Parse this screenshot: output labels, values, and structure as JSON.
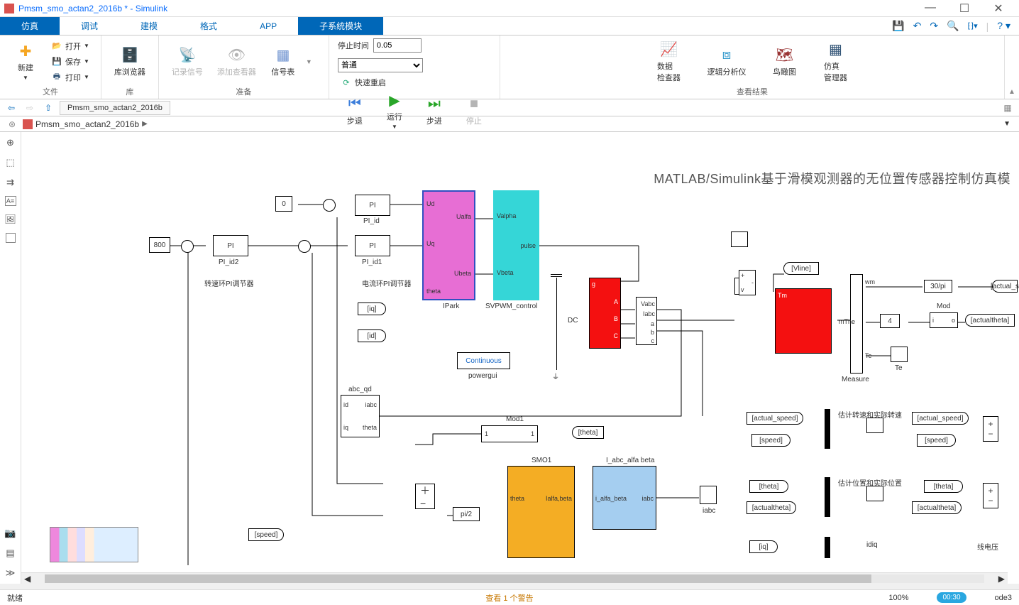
{
  "title": "Pmsm_smo_actan2_2016b * - Simulink",
  "tabs": [
    "仿真",
    "调试",
    "建模",
    "格式",
    "APP",
    "子系统模块"
  ],
  "activeTab": 0,
  "ribbon": {
    "file": {
      "new": "新建",
      "open": "打开",
      "save": "保存",
      "print": "打印",
      "group": "文件"
    },
    "library": {
      "browser": "库浏览器",
      "group": "库"
    },
    "prep": {
      "log": "记录信号",
      "addViewer": "添加查看器",
      "sigTable": "信号表",
      "group": "准备"
    },
    "sim": {
      "stopLabel": "停止时间",
      "stopValue": "0.05",
      "modeValue": "普通",
      "fastRestart": "快速重启",
      "back": "步退",
      "run": "运行",
      "forward": "步进",
      "stop": "停止",
      "group": "仿真"
    },
    "results": {
      "dataInspect": "数据\n检查器",
      "logicAnalyzer": "逻辑分析仪",
      "birdsEye": "鸟瞰图",
      "simManager": "仿真\n管理器",
      "group": "查看结果"
    }
  },
  "nav": {
    "modelTab": "Pmsm_smo_actan2_2016b"
  },
  "breadcrumb": {
    "model": "Pmsm_smo_actan2_2016b"
  },
  "diagram": {
    "title": "MATLAB/Simulink基于滑模观测器的无位置传感器控制仿真模",
    "const0": "0",
    "const800": "800",
    "PI": "PI",
    "PI_id2": "PI_id2",
    "PI_id": "PI_id",
    "PI_id1": "PI_id1",
    "speedLoopNote": "转速环PI调节器",
    "currentLoopNote": "电流环PI调节器",
    "iq": "[iq]",
    "id": "[id]",
    "IPark": "IPark",
    "IPark_ports": {
      "Ud": "Ud",
      "Uq": "Uq",
      "theta": "theta",
      "Ualfa": "Ualfa",
      "Ubeta": "Ubeta"
    },
    "SVPWM": "SVPWM_control",
    "SVPWM_ports": {
      "Valpha": "Valpha",
      "Vbeta": "Vbeta",
      "pulse": "pulse"
    },
    "DC": "DC",
    "Continuous": "Continuous",
    "powergui": "powergui",
    "abc_qd": "abc_qd",
    "abc_qd_ports": {
      "id": "id",
      "iq": "iq",
      "iabc": "iabc",
      "theta": "theta"
    },
    "Mod1": "Mod1",
    "theta_tag": "[theta]",
    "SMO1": "SMO1",
    "SMO_ports": {
      "theta": "theta",
      "Ialfa_beta": "Ialfa,beta"
    },
    "Iabc_ab": "I_abc_alfa beta",
    "Iabc_ab_ports": {
      "i_alfa_beta": "i_alfa_beta",
      "iabc": "iabc"
    },
    "iabc_lbl": "iabc",
    "pi2": "pi/2",
    "speed_tag": "[speed]",
    "Vline": "[Vline]",
    "Vabc": "Vabc",
    "Iabc": "Iabc",
    "abc": [
      "a",
      "b",
      "c"
    ],
    "Tm": "Tm",
    "wm": "wm",
    "mThe": "mThe",
    "Te": "Te",
    "Measure": "Measure",
    "gain30pi": "30/pi",
    "Mod": "Mod",
    "Te2": "Te",
    "actual_speed": "[actual_s",
    "actualtheta": "[actualtheta]",
    "est_speed_note": "估计转速和实际转速",
    "est_pos_note": "估计位置和实际位置",
    "idiq": "idiq",
    "line_volt": "线电压",
    "tags": {
      "actual_speed": "[actual_speed]",
      "speed": "[speed]",
      "theta": "[theta]",
      "actualtheta": "[actualtheta]",
      "iq": "[iq]"
    },
    "one": "1",
    "four": "4",
    "mod_io": {
      "i": "i",
      "o": "o"
    },
    "meas_labels": {
      "g": "g",
      "A": "A",
      "B": "B",
      "C": "C"
    }
  },
  "status": {
    "ready": "就绪",
    "warning": "查看 1 个警告",
    "zoom": "100%",
    "time": "00:30",
    "solver": "ode3"
  }
}
